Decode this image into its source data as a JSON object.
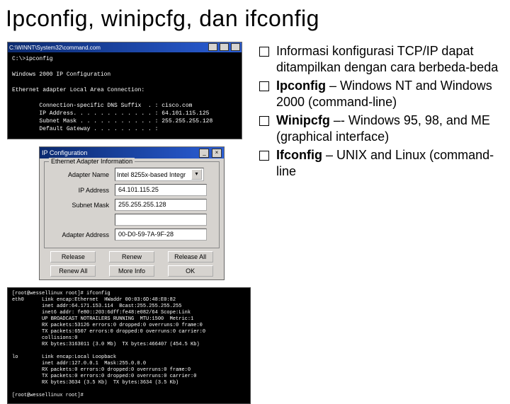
{
  "title": "Ipconfig, winipcfg, dan ifconfig",
  "cmd": {
    "titlebar": "C:\\WINNT\\System32\\command.com",
    "prompt": "C:\\>ipconfig",
    "header": "Windows 2000 IP Configuration",
    "adapter": "Ethernet adapter Local Area Connection:",
    "l1": "        Connection-specific DNS Suffix  . : cisco.com",
    "l2": "        IP Address. . . . . . . . . . . . : 64.101.115.125",
    "l3": "        Subnet Mask . . . . . . . . . . . : 255.255.255.128",
    "l4": "        Default Gateway . . . . . . . . . :"
  },
  "ipcfg": {
    "title": "IP Configuration",
    "group": "Ethernet Adapter Information",
    "adapter_value": "Intel 8255x-based Integr",
    "lbl_adapter": "Adapter Name",
    "lbl_ip": "IP Address",
    "lbl_mask": "Subnet Mask",
    "lbl_gw": "",
    "lbl_hw": "Adapter Address",
    "ip": "64.101.115.25",
    "mask": "255.255.255.128",
    "gw": "",
    "hw": "00-D0-59-7A-9F-28",
    "btn_release": "Release",
    "btn_renew": "Renew",
    "btn_releaseall": "Release All",
    "btn_renewall": "Renew All",
    "btn_more": "More Info",
    "btn_ok": "OK"
  },
  "ifc": {
    "prompt1": "[root@wessellinux root]# ifconfig",
    "l1": "eth0      Link encap:Ethernet  HWaddr 00:03:6D:48:E0:82",
    "l2": "          inet addr:64.171.153.114  Bcast:255.255.255.255",
    "l3": "          inet6 addr: fe80::203:6dff:fe48:e082/64 Scope:Link",
    "l4": "          UP BROADCAST NOTRAILERS RUNNING  MTU:1500  Metric:1",
    "l5": "          RX packets:53126 errors:0 dropped:0 overruns:0 frame:0",
    "l6": "          TX packets:6507 errors:0 dropped:0 overruns:0 carrier:0",
    "l7": "          collisions:0",
    "l8": "          RX bytes:3163011 (3.0 Mb)  TX bytes:466407 (454.5 Kb)",
    "blank": "",
    "l9": "lo        Link encap:Local Loopback",
    "l10": "          inet addr:127.0.0.1  Mask:255.0.0.0",
    "l11": "          RX packets:0 errors:0 dropped:0 overruns:0 frame:0",
    "l12": "          TX packets:0 errors:0 dropped:0 overruns:0 carrier:0",
    "l13": "          RX bytes:3634 (3.5 Kb)  TX bytes:3634 (3.5 Kb)",
    "prompt2": "[root@wessellinux root]#"
  },
  "bullets": {
    "b1": "Informasi konfigurasi TCP/IP dapat ditampilkan dengan cara berbeda-beda",
    "b2_bold": "Ipconfig",
    "b2_rest": " – Windows NT and Windows 2000 (command-line)",
    "b3_bold": "Winipcfg",
    "b3_rest": " –- Windows 95, 98, and ME (graphical interface)",
    "b4_bold": "Ifconfig",
    "b4_rest": " – UNIX and Linux (command-line"
  }
}
